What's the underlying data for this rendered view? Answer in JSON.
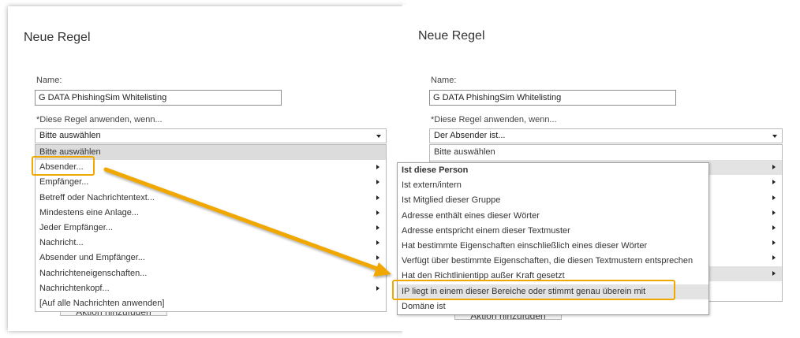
{
  "left": {
    "title": "Neue Regel",
    "name_label": "Name:",
    "name_value": "G DATA PhishingSim Whitelisting",
    "condition_label": "*Diese Regel anwenden, wenn...",
    "select_value": "Bitte auswählen",
    "menu_header": "Bitte auswählen",
    "menu_items": [
      "Absender...",
      "Empfänger...",
      "Betreff oder Nachrichtentext...",
      "Mindestens eine Anlage...",
      "Jeder Empfänger...",
      "Nachricht...",
      "Absender und Empfänger...",
      "Nachrichteneigenschaften...",
      "Nachrichtenkopf...",
      "[Auf alle Nachrichten anwenden]"
    ],
    "add_action_button": "Aktion hinzufügen"
  },
  "right": {
    "title": "Neue Regel",
    "name_label": "Name:",
    "name_value": "G DATA PhishingSim Whitelisting",
    "condition_label": "*Diese Regel anwenden, wenn...",
    "select_value": "Der Absender ist...",
    "menu_header": "Bitte auswählen",
    "submenu_items": [
      "Ist diese Person",
      "Ist extern/intern",
      "Ist Mitglied dieser Gruppe",
      "Adresse enthält eines dieser Wörter",
      "Adresse entspricht einem dieser Textmuster",
      "Hat bestimmte Eigenschaften einschließlich eines dieser Wörter",
      "Verfügt über bestimmte Eigenschaften, die diesen Textmustern entsprechen",
      "Hat den Richtlinientipp außer Kraft gesetzt",
      "IP liegt in einem dieser Bereiche oder stimmt genau überein mit",
      "Domäne ist"
    ],
    "add_action_button": "Aktion hinzufügen"
  },
  "accent_color": "#f0a800"
}
